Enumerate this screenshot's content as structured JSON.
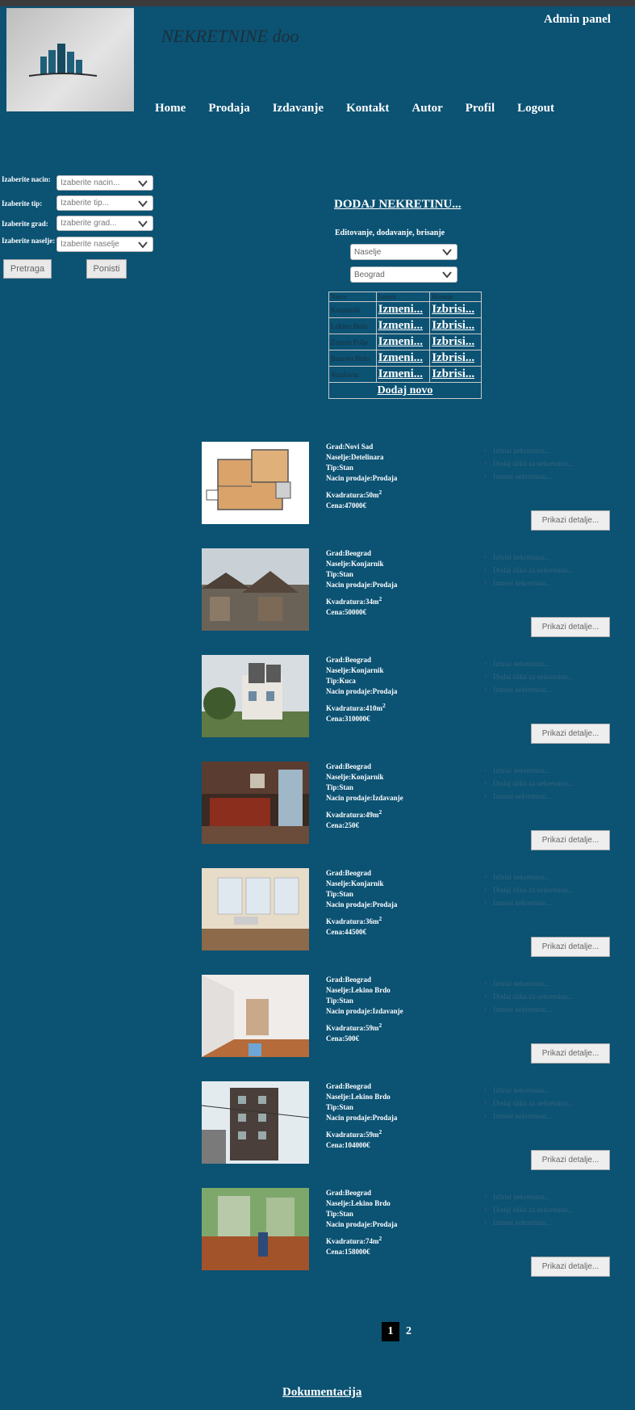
{
  "header": {
    "site_title": "NEKRETNINE doo",
    "admin_link": "Admin panel",
    "nav": [
      "Home",
      "Prodaja",
      "Izdavanje",
      "Kontakt",
      "Autor",
      "Profil",
      "Logout"
    ]
  },
  "filters": {
    "fields": [
      {
        "label": "Izaberite nacin:",
        "value": "Izaberite nacin..."
      },
      {
        "label": "Izaberite tip:",
        "value": "Izaberite tip..."
      },
      {
        "label": "Izaberite grad:",
        "value": "Izaberite grad..."
      },
      {
        "label": "Izaberite naselje:",
        "value": "Izaberite naselje"
      }
    ],
    "search_button": "Pretraga",
    "reset_button": "Ponisti"
  },
  "admin": {
    "add_heading": "DODAJ NEKRETINU...",
    "sub_heading": "Editovanje, dodavanje, brisanje",
    "select1": "Naselje",
    "select2": "Beograd",
    "table": {
      "headers": [
        "Naziv",
        "Izmeni",
        "Brisanje"
      ],
      "rows": [
        {
          "name": "Konjarnik",
          "edit": "Izmeni...",
          "delete": "Izbrisi..."
        },
        {
          "name": "Lekino Brdo",
          "edit": "Izmeni...",
          "delete": "Izbrisi..."
        },
        {
          "name": "Zemun Polje",
          "edit": "Izmeni...",
          "delete": "Izbrisi..."
        },
        {
          "name": "Banovo Brdo",
          "edit": "Izmeni...",
          "delete": "Izbrisi..."
        },
        {
          "name": "Vozdovac",
          "edit": "Izmeni...",
          "delete": "Izbrisi..."
        }
      ],
      "add_new": "Dodaj novo"
    }
  },
  "listing_option_labels": [
    "Izbrisi nekretninu...",
    "Dodaj sliku za nekretninu...",
    "Izmeni nekretninu..."
  ],
  "detail_button": "Prikazi detalje...",
  "listings": [
    {
      "grad": "Grad:Novi Sad",
      "naselje": "Naselje:Detelinara",
      "tip": "Tip:Stan",
      "nacin": "Nacin prodaje:Prodaja",
      "kvadratura": "Kvadratura:50m",
      "cena": "Cena:47000€",
      "photo": "floorplan"
    },
    {
      "grad": "Grad:Beograd",
      "naselje": "Naselje:Konjarnik",
      "tip": "Tip:Stan",
      "nacin": "Nacin prodaje:Prodaja",
      "kvadratura": "Kvadratura:34m",
      "cena": "Cena:50000€",
      "photo": "rooftops"
    },
    {
      "grad": "Grad:Beograd",
      "naselje": "Naselje:Konjarnik",
      "tip": "Tip:Kuca",
      "nacin": "Nacin prodaje:Prodaja",
      "kvadratura": "Kvadratura:410m",
      "cena": "Cena:310000€",
      "photo": "house"
    },
    {
      "grad": "Grad:Beograd",
      "naselje": "Naselje:Konjarnik",
      "tip": "Tip:Stan",
      "nacin": "Nacin prodaje:Izdavanje",
      "kvadratura": "Kvadratura:49m",
      "cena": "Cena:250€",
      "photo": "kitchen"
    },
    {
      "grad": "Grad:Beograd",
      "naselje": "Naselje:Konjarnik",
      "tip": "Tip:Stan",
      "nacin": "Nacin prodaje:Prodaja",
      "kvadratura": "Kvadratura:36m",
      "cena": "Cena:44500€",
      "photo": "windows"
    },
    {
      "grad": "Grad:Beograd",
      "naselje": "Naselje:Lekino Brdo",
      "tip": "Tip:Stan",
      "nacin": "Nacin prodaje:Izdavanje",
      "kvadratura": "Kvadratura:59m",
      "cena": "Cena:500€",
      "photo": "room"
    },
    {
      "grad": "Grad:Beograd",
      "naselje": "Naselje:Lekino Brdo",
      "tip": "Tip:Stan",
      "nacin": "Nacin prodaje:Prodaja",
      "kvadratura": "Kvadratura:59m",
      "cena": "Cena:104000€",
      "photo": "building"
    },
    {
      "grad": "Grad:Beograd",
      "naselje": "Naselje:Lekino Brdo",
      "tip": "Tip:Stan",
      "nacin": "Nacin prodaje:Prodaja",
      "kvadratura": "Kvadratura:74m",
      "cena": "Cena:158000€",
      "photo": "greenroom"
    }
  ],
  "pagination": {
    "current": "1",
    "next": "2"
  },
  "footer": {
    "docs_link": "Dokumentacija"
  },
  "colors": {
    "background": "#0b5273",
    "title": "#1c2f3a",
    "pager_active": "#000000"
  }
}
